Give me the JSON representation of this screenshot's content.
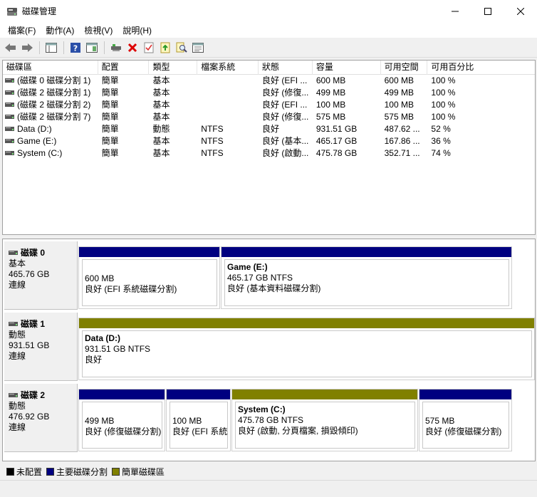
{
  "window": {
    "title": "磁碟管理"
  },
  "menu": [
    "檔案(F)",
    "動作(A)",
    "檢視(V)",
    "說明(H)"
  ],
  "toolbar": {
    "icons": [
      "back-icon",
      "forward-icon",
      "console-icon",
      "help-icon",
      "view-icon",
      "connect-icon",
      "delete-icon",
      "check-icon",
      "export-icon",
      "search-icon",
      "properties-icon"
    ]
  },
  "volumes": {
    "headers": [
      "磁碟區",
      "配置",
      "類型",
      "檔案系統",
      "狀態",
      "容量",
      "可用空間",
      "可用百分比"
    ],
    "rows": [
      [
        "(磁碟 0 磁碟分割 1)",
        "簡單",
        "基本",
        "",
        "良好 (EFI ...",
        "600 MB",
        "600 MB",
        "100 %"
      ],
      [
        "(磁碟 2 磁碟分割 1)",
        "簡單",
        "基本",
        "",
        "良好 (修復...",
        "499 MB",
        "499 MB",
        "100 %"
      ],
      [
        "(磁碟 2 磁碟分割 2)",
        "簡單",
        "基本",
        "",
        "良好 (EFI ...",
        "100 MB",
        "100 MB",
        "100 %"
      ],
      [
        "(磁碟 2 磁碟分割 7)",
        "簡單",
        "基本",
        "",
        "良好 (修復...",
        "575 MB",
        "575 MB",
        "100 %"
      ],
      [
        "Data (D:)",
        "簡單",
        "動態",
        "NTFS",
        "良好",
        "931.51 GB",
        "487.62 ...",
        "52 %"
      ],
      [
        "Game (E:)",
        "簡單",
        "基本",
        "NTFS",
        "良好 (基本...",
        "465.17 GB",
        "167.86 ...",
        "36 %"
      ],
      [
        "System (C:)",
        "簡單",
        "基本",
        "NTFS",
        "良好 (啟動...",
        "475.78 GB",
        "352.71 ...",
        "74 %"
      ]
    ]
  },
  "disks": [
    {
      "name": "磁碟 0",
      "type": "基本",
      "size": "465.76 GB",
      "status": "連線",
      "partitions": [
        {
          "name": "",
          "size": "600 MB",
          "status": "良好 (EFI 系統磁碟分割)",
          "kind": "primary"
        },
        {
          "name": "Game  (E:)",
          "size": "465.17 GB NTFS",
          "status": "良好 (基本資料磁碟分割)",
          "kind": "primary"
        }
      ]
    },
    {
      "name": "磁碟 1",
      "type": "動態",
      "size": "931.51 GB",
      "status": "連線",
      "partitions": [
        {
          "name": "Data  (D:)",
          "size": "931.51 GB NTFS",
          "status": "良好",
          "kind": "simple"
        }
      ]
    },
    {
      "name": "磁碟 2",
      "type": "動態",
      "size": "476.92 GB",
      "status": "連線",
      "partitions": [
        {
          "name": "",
          "size": "499 MB",
          "status": "良好 (修復磁碟分割)",
          "kind": "primary"
        },
        {
          "name": "",
          "size": "100 MB",
          "status": "良好 (EFI 系統",
          "kind": "primary"
        },
        {
          "name": "System  (C:)",
          "size": "475.78 GB NTFS",
          "status": "良好 (啟動, 分頁檔案, 損毀傾印)",
          "kind": "simple"
        },
        {
          "name": "",
          "size": "575 MB",
          "status": "良好 (修復磁碟分割)",
          "kind": "primary"
        }
      ]
    }
  ],
  "legend": [
    {
      "label": "未配置",
      "color": "#000000"
    },
    {
      "label": "主要磁碟分割",
      "color": "#000080"
    },
    {
      "label": "簡單磁碟區",
      "color": "#808000"
    }
  ],
  "colors": {
    "primary": "#000080",
    "simple": "#808000",
    "unallocated": "#000000"
  }
}
